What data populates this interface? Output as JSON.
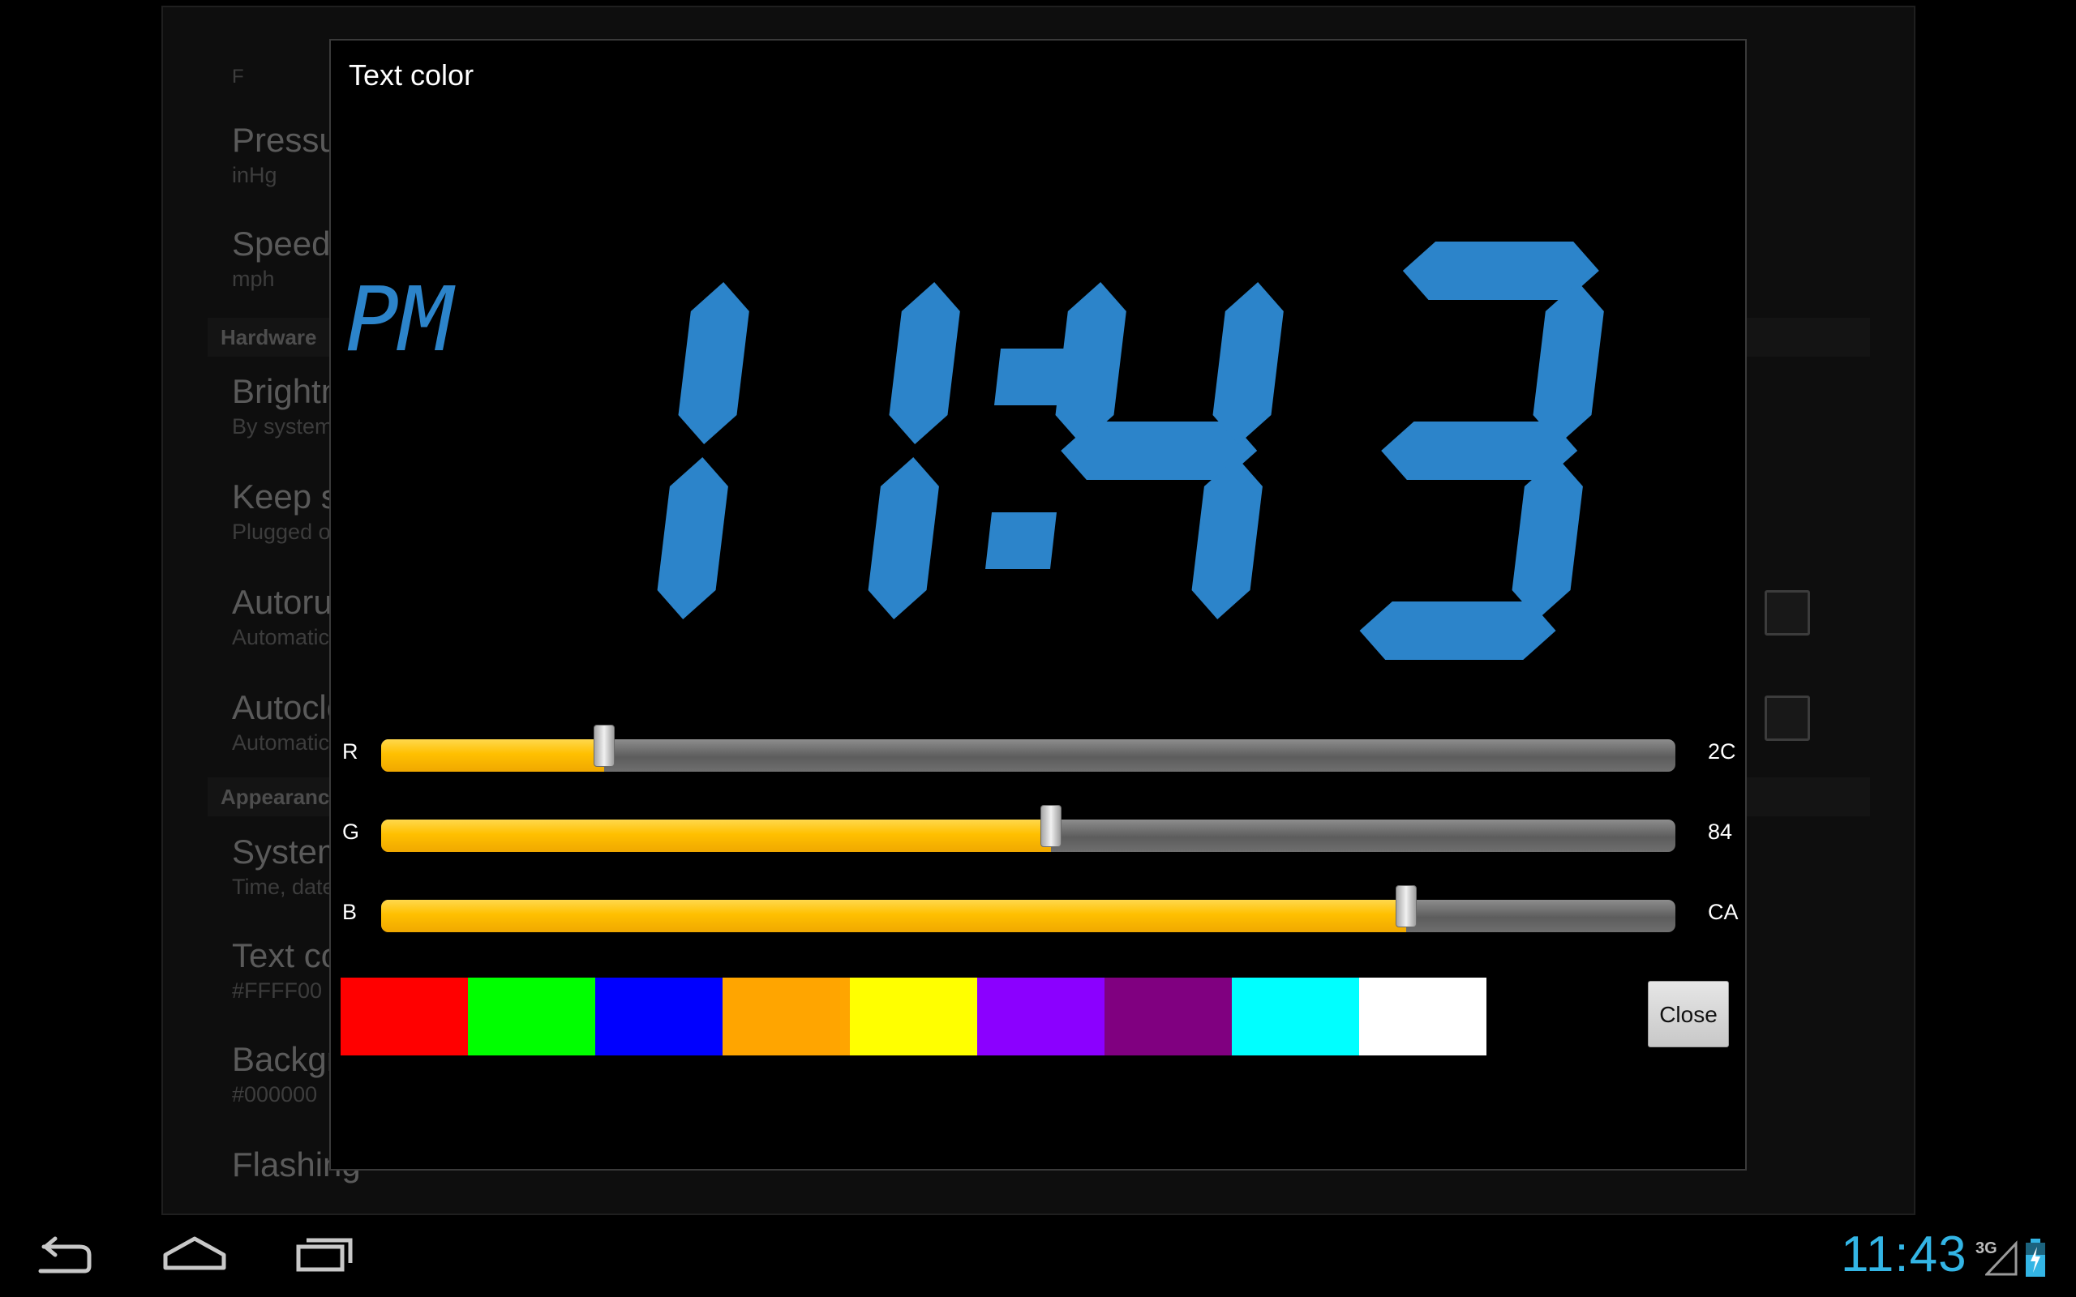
{
  "settings": {
    "partial_top": "F",
    "items": [
      {
        "title": "Pressure",
        "subtitle": "inHg"
      },
      {
        "title": "Speed",
        "subtitle": "mph"
      },
      {
        "title": "Brightness",
        "subtitle": "By system"
      },
      {
        "title": "Keep screen on",
        "subtitle": "Plugged on"
      },
      {
        "title": "Autorun",
        "subtitle": "Automatic"
      },
      {
        "title": "Autoclose",
        "subtitle": "Automatic"
      },
      {
        "title": "System",
        "subtitle": "Time, date"
      },
      {
        "title": "Text color",
        "subtitle": "#FFFF00"
      },
      {
        "title": "Background",
        "subtitle": "#000000"
      },
      {
        "title": "Flashing",
        "subtitle": ""
      }
    ],
    "headers": {
      "hardware": "Hardware",
      "appearance": "Appearance"
    }
  },
  "dialog": {
    "title": "Text color",
    "clock": {
      "ampm": "PM",
      "time": "11:43",
      "color": "#2c84ca"
    },
    "sliders": [
      {
        "label": "R",
        "value_hex": "2C",
        "level": 0.1725
      },
      {
        "label": "G",
        "value_hex": "84",
        "level": 0.5176
      },
      {
        "label": "B",
        "value_hex": "CA",
        "level": 0.7922
      }
    ],
    "swatches": [
      "#ff0000",
      "#00ff00",
      "#0000ff",
      "#ffa500",
      "#ffff00",
      "#8b00ff",
      "#800080",
      "#00ffff",
      "#ffffff"
    ],
    "close_label": "Close"
  },
  "statusbar": {
    "time": "11:43",
    "network": "3G"
  },
  "navbar": {
    "icons": [
      "back-icon",
      "home-icon",
      "recent-apps-icon"
    ]
  }
}
